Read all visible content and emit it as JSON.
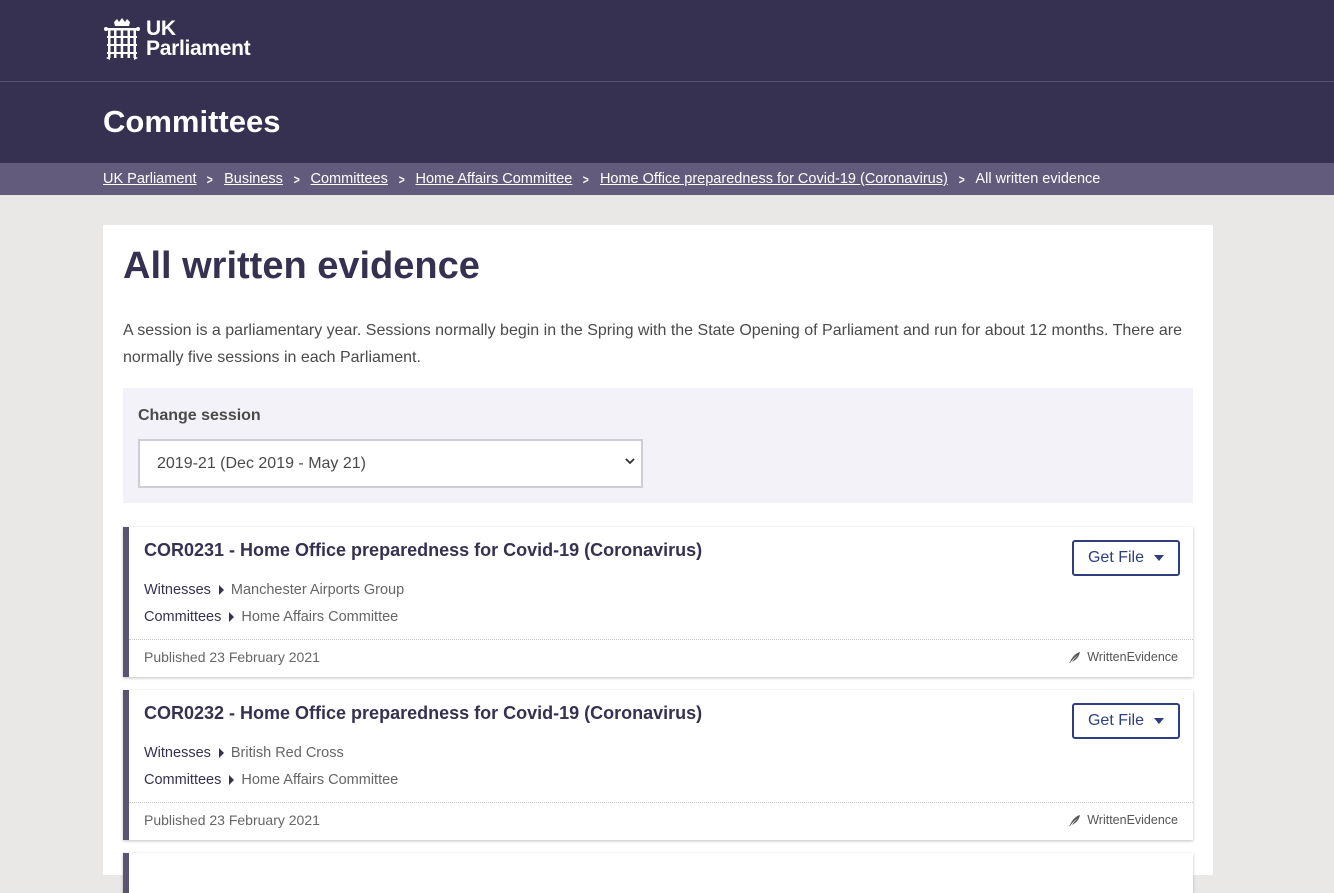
{
  "header": {
    "logo_line1": "UK",
    "logo_line2": "Parliament",
    "section_title": "Committees"
  },
  "breadcrumb": {
    "items": [
      "UK Parliament",
      "Business",
      "Committees",
      "Home Affairs Committee",
      "Home Office preparedness for Covid-19 (Coronavirus)"
    ],
    "current": "All written evidence"
  },
  "main": {
    "title": "All written evidence",
    "intro": "A session is a parliamentary year. Sessions normally begin in the Spring with the State Opening of Parliament and run for about 12 months. There are normally five sessions in each Parliament.",
    "session_label": "Change session",
    "session_value": "2019-21 (Dec 2019 - May 21)"
  },
  "evidence": [
    {
      "title": "COR0231 - Home Office preparedness for Covid-19 (Coronavirus)",
      "witnesses_label": "Witnesses",
      "witnesses": "Manchester Airports Group",
      "committees_label": "Committees",
      "committees": "Home Affairs Committee",
      "published": "Published 23 February 2021",
      "type": "WrittenEvidence",
      "button": "Get File"
    },
    {
      "title": "COR0232 - Home Office preparedness for Covid-19 (Coronavirus)",
      "witnesses_label": "Witnesses",
      "witnesses": "British Red Cross",
      "committees_label": "Committees",
      "committees": "Home Affairs Committee",
      "published": "Published 23 February 2021",
      "type": "WrittenEvidence",
      "button": "Get File"
    }
  ],
  "colors": {
    "header_bg": "#373151",
    "breadcrumb_bg": "#635b7c",
    "button_blue": "#2e3e7e",
    "page_bg": "#e9e8e6"
  }
}
